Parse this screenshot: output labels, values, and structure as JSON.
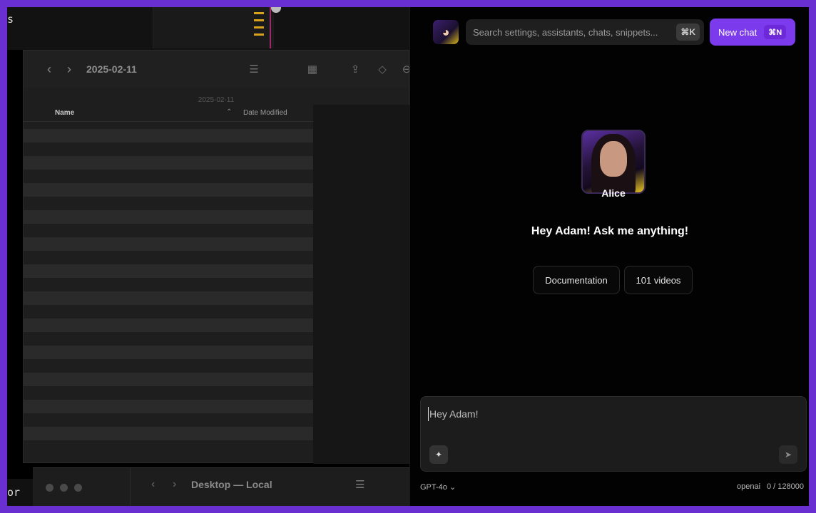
{
  "background_desktop": {
    "top_left_text": "s",
    "bottom_left_text": "or",
    "finder": {
      "title": "2025-02-11",
      "path_label": "2025-02-11",
      "columns": {
        "name": "Name",
        "date_modified": "Date Modified"
      }
    },
    "dock_window": {
      "title": "Desktop — Local"
    }
  },
  "chat": {
    "search": {
      "placeholder": "Search settings, assistants, chats, snippets...",
      "shortcut": "⌘K"
    },
    "new_chat": {
      "label": "New chat",
      "shortcut": "⌘N"
    },
    "assistant": {
      "name": "Alice"
    },
    "greeting": "Hey Adam! Ask me anything!",
    "quick_links": [
      "Documentation",
      "101 videos"
    ],
    "composer": {
      "value": "Hey Adam!"
    },
    "footer": {
      "model": "GPT-4o",
      "provider": "openai",
      "tokens": "0 / 128000"
    }
  },
  "colors": {
    "accent": "#7c3aed",
    "backdrop": "#6a2fd0",
    "panel": "#020202"
  }
}
